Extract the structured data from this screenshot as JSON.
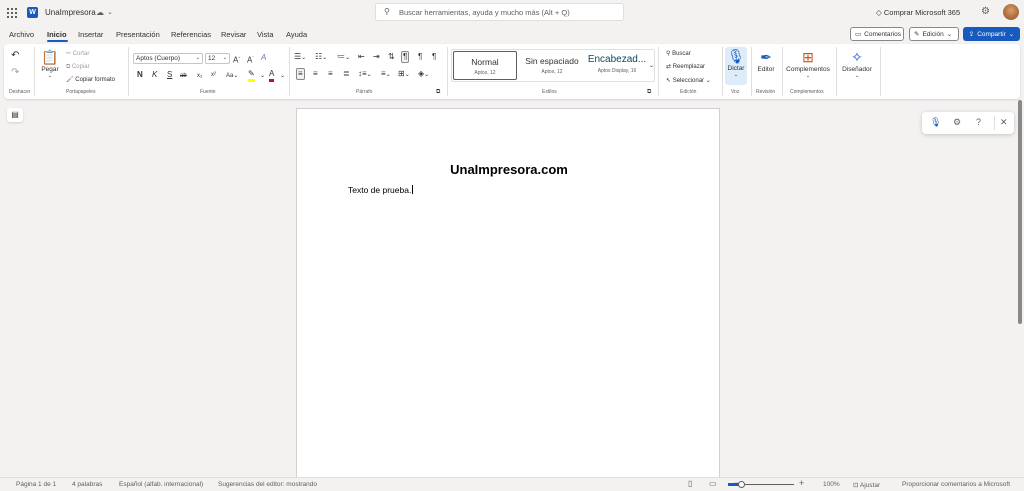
{
  "titlebar": {
    "doc_title": "UnaImpresora",
    "search_placeholder": "Buscar herramientas, ayuda y mucho más (Alt + Q)",
    "buy_label": "Comprar Microsoft 365"
  },
  "tabs": [
    "Archivo",
    "Inicio",
    "Insertar",
    "Presentación",
    "Referencias",
    "Revisar",
    "Vista",
    "Ayuda"
  ],
  "active_tab": "Inicio",
  "actions": {
    "comments": "Comentarios",
    "editing": "Edición",
    "share": "Compartir"
  },
  "ribbon": {
    "undo_group": "Deshacer",
    "clipboard": {
      "paste": "Pegar",
      "cut": "Cortar",
      "copy": "Copiar",
      "format_painter": "Copiar formato",
      "group": "Portapapeles"
    },
    "font": {
      "family": "Aptos (Cuerpo)",
      "size": "12",
      "bold": "N",
      "italic": "K",
      "underline": "S",
      "strike": "ab",
      "group": "Fuente"
    },
    "paragraph": {
      "group": "Párrafo"
    },
    "styles": {
      "items": [
        {
          "name": "Normal",
          "sub": "Aptos, 12"
        },
        {
          "name": "Sin espaciado",
          "sub": "Aptos, 12"
        },
        {
          "name": "Encabezad...",
          "sub": "Aptos Display, 16"
        }
      ],
      "group": "Estilos"
    },
    "editing": {
      "find": "Buscar",
      "replace": "Reemplazar",
      "select": "Seleccionar",
      "group": "Edición"
    },
    "voice": {
      "dictate": "Dictar",
      "group": "Voz"
    },
    "review": {
      "editor": "Editor",
      "group": "Revisión"
    },
    "addins": {
      "label": "Complementos",
      "group": "Complementos"
    },
    "designer": {
      "label": "Diseñador"
    }
  },
  "document": {
    "heading": "UnaImpresora.com",
    "body": "Texto de prueba."
  },
  "status": {
    "page": "Página 1 de 1",
    "words": "4 palabras",
    "language": "Español (alfab. internacional)",
    "editor_suggestions": "Sugerencias del editor: mostrando",
    "zoom_minus": "−",
    "zoom_plus": "+",
    "zoom": "100%",
    "fit": "Ajustar",
    "feedback": "Proporcionar comentarios a Microsoft",
    "zoom_level_percent": 100
  },
  "colors": {
    "accent": "#185abd",
    "highlight": "#ffff00",
    "font_color": "#c50f1f"
  }
}
